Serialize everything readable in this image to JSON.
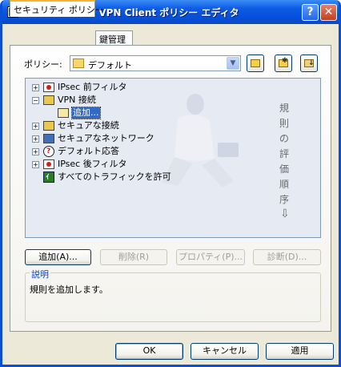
{
  "window": {
    "title": "NET-G Secure VPN Client ポリシー エディタ",
    "help_glyph": "?",
    "close_glyph": "✕"
  },
  "tabs": [
    {
      "label": "セキュリティ ポリシー",
      "active": true
    },
    {
      "label": "鍵管理",
      "active": false
    }
  ],
  "policy": {
    "label": "ポリシー:",
    "selected": "デフォルト"
  },
  "tree": {
    "items": [
      {
        "label": "IPsec 前フィルタ",
        "icon": "filter-red-icon",
        "expander": "+"
      },
      {
        "label": "VPN 接続",
        "icon": "vpn-icon",
        "expander": "−"
      },
      {
        "label": "追加...",
        "icon": "add-rule-icon",
        "expander": "",
        "selected": true
      },
      {
        "label": "セキュアな接続",
        "icon": "secure-connection-icon",
        "expander": "+"
      },
      {
        "label": "セキュアなネットワーク",
        "icon": "secure-network-icon",
        "expander": "+"
      },
      {
        "label": "デフォルト応答",
        "icon": "default-response-icon",
        "expander": "+"
      },
      {
        "label": "IPsec 後フィルタ",
        "icon": "filter-red-icon",
        "expander": "+"
      },
      {
        "label": "すべてのトラフィックを許可",
        "icon": "allow-traffic-icon",
        "expander": ""
      }
    ],
    "order_chars": [
      "規",
      "則",
      "の",
      "評",
      "価",
      "順",
      "序"
    ],
    "order_arrow": "⇩"
  },
  "action_buttons": {
    "add": "追加(A)...",
    "delete": "削除(R)",
    "properties": "プロパティ(P)...",
    "diagnose": "診断(D)..."
  },
  "description": {
    "title": "説明",
    "text": "規則を追加します。"
  },
  "footer_buttons": {
    "ok": "OK",
    "cancel": "キャンセル",
    "apply": "適用"
  }
}
